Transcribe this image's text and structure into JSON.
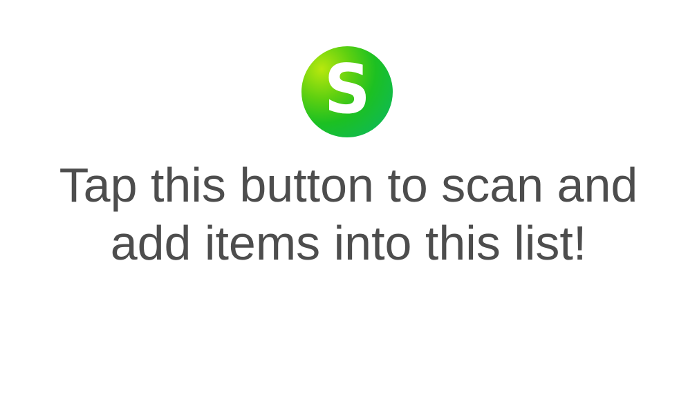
{
  "scan_button": {
    "letter": "S",
    "icon": "scan-logo-icon",
    "colors": {
      "gradient_start": "#b8e80e",
      "gradient_mid": "#1cc022",
      "gradient_end": "#09b86a",
      "letter": "#ffffff"
    }
  },
  "hint": {
    "line1": "Tap this button to scan and",
    "line2": "add items into this list!",
    "color": "#4d4d4d"
  }
}
